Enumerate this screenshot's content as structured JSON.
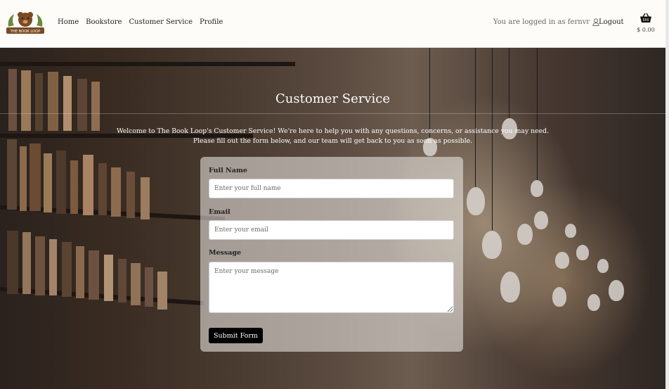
{
  "brand": {
    "logo_text": "THE BOOK LOOP"
  },
  "nav": {
    "links": [
      "Home",
      "Bookstore",
      "Customer Service",
      "Profile"
    ]
  },
  "account": {
    "status_text": "You are logged in as fernvr",
    "logout_label": "Logout",
    "cart_total": "$ 0.00"
  },
  "page": {
    "title": "Customer Service",
    "intro_line1": "Welcome to The Book Loop's Customer Service! We're here to help you with any questions, concerns, or assistance you may need.",
    "intro_line2": "Please fill out the form below, and our team will get back to you as soon as possible."
  },
  "form": {
    "name_label": "Full Name",
    "name_placeholder": "Enter your full name",
    "email_label": "Email",
    "email_placeholder": "Enter your email",
    "message_label": "Message",
    "message_placeholder": "Enter your message",
    "submit_label": "Submit Form"
  },
  "icons": [
    "user-icon",
    "basket-icon"
  ],
  "colors": {
    "nav_bg": "#fdfcf8",
    "button_bg": "#000000",
    "logo_brown": "#7a4a22"
  }
}
